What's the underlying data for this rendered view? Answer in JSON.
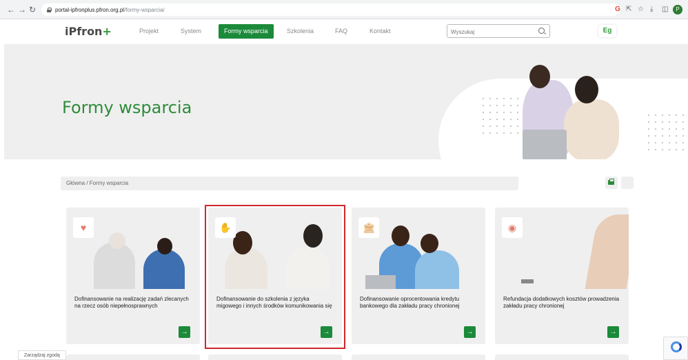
{
  "browser": {
    "url_host": "portal-ipfronplus.pfron.org.pl",
    "url_path": "/formy-wsparcia/",
    "profile_initial": "P"
  },
  "header": {
    "logo_text": "iPfron",
    "logo_plus": "+",
    "menu": [
      "Projekt",
      "System",
      "Formy wsparcia",
      "Szkolenia",
      "FAQ",
      "Kontakt"
    ],
    "active_menu": "Formy wsparcia",
    "search_placeholder": "Wyszukaj",
    "lang_button": "Eg"
  },
  "hero": {
    "title": "Formy wsparcia"
  },
  "breadcrumb": {
    "text": "Główna / Formy wsparcia"
  },
  "cards": [
    {
      "title": "Dofinansowanie na realizację zadań zlecanych na rzecz osób niepełnosprawnych",
      "icon": "heart-icon"
    },
    {
      "title": "Dofinansowanie do szkolenia z języka migowego i innych środków komunikowania się",
      "icon": "sign-language-icon"
    },
    {
      "title": "Dofinansowanie oprocentowania kredytu bankowego dla zakładu pracy chronionej",
      "icon": "bank-icon"
    },
    {
      "title": "Refundacja dodatkowych kosztów prowadzenia zakładu pracy chronionej",
      "icon": "coin-icon"
    }
  ],
  "cookie_button": "Zarządzaj zgodą",
  "colors": {
    "brand_green": "#1b8a3a",
    "highlight_red": "#d0242b"
  }
}
